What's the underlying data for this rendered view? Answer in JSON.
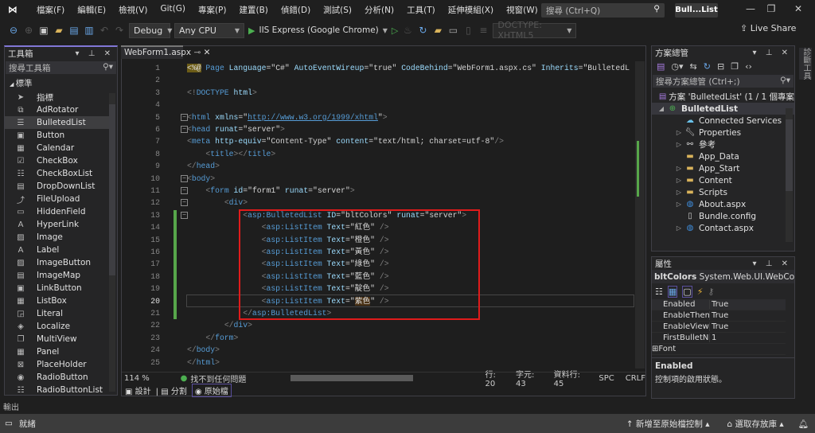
{
  "menu": {
    "items": [
      "檔案(F)",
      "編輯(E)",
      "檢視(V)",
      "Git(G)",
      "專案(P)",
      "建置(B)",
      "偵錯(D)",
      "測試(S)",
      "分析(N)",
      "工具(T)",
      "延伸模組(X)",
      "視窗(W)",
      "說明(H)"
    ],
    "search_placeholder": "搜尋 (Ctrl+Q)",
    "solution_title": "Bull...List"
  },
  "toolbar": {
    "config": "Debug",
    "platform": "Any CPU",
    "run_target": "IIS Express (Google Chrome)",
    "doctype": "DOCTYPE: XHTML5",
    "live_share": "Live Share"
  },
  "toolbox": {
    "title": "工具箱",
    "search_placeholder": "搜尋工具箱",
    "category": "標準",
    "items": [
      {
        "label": "指標",
        "icon": "pointer-icon"
      },
      {
        "label": "AdRotator",
        "icon": "adrotator-icon"
      },
      {
        "label": "BulletedList",
        "icon": "bulleted-list-icon",
        "selected": true
      },
      {
        "label": "Button",
        "icon": "button-icon"
      },
      {
        "label": "Calendar",
        "icon": "calendar-icon"
      },
      {
        "label": "CheckBox",
        "icon": "checkbox-icon"
      },
      {
        "label": "CheckBoxList",
        "icon": "checkbox-list-icon"
      },
      {
        "label": "DropDownList",
        "icon": "dropdown-list-icon"
      },
      {
        "label": "FileUpload",
        "icon": "file-upload-icon"
      },
      {
        "label": "HiddenField",
        "icon": "hidden-field-icon"
      },
      {
        "label": "HyperLink",
        "icon": "hyperlink-icon"
      },
      {
        "label": "Image",
        "icon": "image-icon"
      },
      {
        "label": "Label",
        "icon": "label-icon"
      },
      {
        "label": "ImageButton",
        "icon": "image-button-icon"
      },
      {
        "label": "ImageMap",
        "icon": "image-map-icon"
      },
      {
        "label": "LinkButton",
        "icon": "link-button-icon"
      },
      {
        "label": "ListBox",
        "icon": "listbox-icon"
      },
      {
        "label": "Literal",
        "icon": "literal-icon"
      },
      {
        "label": "Localize",
        "icon": "localize-icon"
      },
      {
        "label": "MultiView",
        "icon": "multiview-icon"
      },
      {
        "label": "Panel",
        "icon": "panel-icon"
      },
      {
        "label": "PlaceHolder",
        "icon": "placeholder-icon"
      },
      {
        "label": "RadioButton",
        "icon": "radio-button-icon"
      },
      {
        "label": "RadioButtonList",
        "icon": "radio-button-list-icon"
      }
    ]
  },
  "editor": {
    "tab": "WebForm1.aspx",
    "current_line": 20,
    "lines": [
      [
        [
          "hl",
          "<%@"
        ],
        [
          "p",
          " "
        ],
        [
          "t",
          "Page"
        ],
        [
          "a",
          " Language"
        ],
        [
          "p",
          "="
        ],
        [
          "s",
          "\"C#\""
        ],
        [
          "a",
          " AutoEventWireup"
        ],
        [
          "p",
          "="
        ],
        [
          "s",
          "\"true\""
        ],
        [
          "a",
          " CodeBehind"
        ],
        [
          "p",
          "="
        ],
        [
          "s",
          "\"WebForm1.aspx.cs\""
        ],
        [
          "a",
          " Inherits"
        ],
        [
          "p",
          "="
        ],
        [
          "s",
          "\"BulletedL"
        ]
      ],
      [],
      [
        [
          "d",
          "<!"
        ],
        [
          "t",
          "DOCTYPE"
        ],
        [
          "a",
          " html"
        ],
        [
          "d",
          ">"
        ]
      ],
      [],
      [
        [
          "d",
          "<"
        ],
        [
          "t",
          "html"
        ],
        [
          "a",
          " xmlns"
        ],
        [
          "p",
          "="
        ],
        [
          "s",
          "\""
        ],
        [
          "u",
          "http://www.w3.org/1999/xhtml"
        ],
        [
          "s",
          "\""
        ],
        [
          "d",
          ">"
        ]
      ],
      [
        [
          "d",
          "<"
        ],
        [
          "t",
          "head"
        ],
        [
          "a",
          " runat"
        ],
        [
          "p",
          "="
        ],
        [
          "s",
          "\"server\""
        ],
        [
          "d",
          ">"
        ]
      ],
      [
        [
          "d",
          "<"
        ],
        [
          "t",
          "meta"
        ],
        [
          "a",
          " http-equiv"
        ],
        [
          "p",
          "="
        ],
        [
          "s",
          "\"Content-Type\""
        ],
        [
          "a",
          " content"
        ],
        [
          "p",
          "="
        ],
        [
          "s",
          "\"text/html; charset=utf-8\""
        ],
        [
          "d",
          "/>"
        ]
      ],
      [
        [
          "p",
          "    "
        ],
        [
          "d",
          "<"
        ],
        [
          "t",
          "title"
        ],
        [
          "d",
          "></"
        ],
        [
          "t",
          "title"
        ],
        [
          "d",
          ">"
        ]
      ],
      [
        [
          "d",
          "</"
        ],
        [
          "t",
          "head"
        ],
        [
          "d",
          ">"
        ]
      ],
      [
        [
          "d",
          "<"
        ],
        [
          "t",
          "body"
        ],
        [
          "d",
          ">"
        ]
      ],
      [
        [
          "p",
          "    "
        ],
        [
          "d",
          "<"
        ],
        [
          "t",
          "form"
        ],
        [
          "a",
          " id"
        ],
        [
          "p",
          "="
        ],
        [
          "s",
          "\"form1\""
        ],
        [
          "a",
          " runat"
        ],
        [
          "p",
          "="
        ],
        [
          "s",
          "\"server\""
        ],
        [
          "d",
          ">"
        ]
      ],
      [
        [
          "p",
          "        "
        ],
        [
          "d",
          "<"
        ],
        [
          "t",
          "div"
        ],
        [
          "d",
          ">"
        ]
      ],
      [
        [
          "p",
          "            "
        ],
        [
          "d",
          "<"
        ],
        [
          "t",
          "asp:BulletedList"
        ],
        [
          "a",
          " ID"
        ],
        [
          "p",
          "="
        ],
        [
          "s",
          "\"bltColors\""
        ],
        [
          "a",
          " runat"
        ],
        [
          "p",
          "="
        ],
        [
          "s",
          "\"server\""
        ],
        [
          "d",
          ">"
        ]
      ],
      [
        [
          "p",
          "                "
        ],
        [
          "d",
          "<"
        ],
        [
          "t",
          "asp:ListItem"
        ],
        [
          "a",
          " Text"
        ],
        [
          "p",
          "="
        ],
        [
          "s",
          "\"紅色\""
        ],
        [
          "d",
          " />"
        ]
      ],
      [
        [
          "p",
          "                "
        ],
        [
          "d",
          "<"
        ],
        [
          "t",
          "asp:ListItem"
        ],
        [
          "a",
          " Text"
        ],
        [
          "p",
          "="
        ],
        [
          "s",
          "\"橙色\""
        ],
        [
          "d",
          " />"
        ]
      ],
      [
        [
          "p",
          "                "
        ],
        [
          "d",
          "<"
        ],
        [
          "t",
          "asp:ListItem"
        ],
        [
          "a",
          " Text"
        ],
        [
          "p",
          "="
        ],
        [
          "s",
          "\"黃色\""
        ],
        [
          "d",
          " />"
        ]
      ],
      [
        [
          "p",
          "                "
        ],
        [
          "d",
          "<"
        ],
        [
          "t",
          "asp:ListItem"
        ],
        [
          "a",
          " Text"
        ],
        [
          "p",
          "="
        ],
        [
          "s",
          "\"綠色\""
        ],
        [
          "d",
          " />"
        ]
      ],
      [
        [
          "p",
          "                "
        ],
        [
          "d",
          "<"
        ],
        [
          "t",
          "asp:ListItem"
        ],
        [
          "a",
          " Text"
        ],
        [
          "p",
          "="
        ],
        [
          "s",
          "\"藍色\""
        ],
        [
          "d",
          " />"
        ]
      ],
      [
        [
          "p",
          "                "
        ],
        [
          "d",
          "<"
        ],
        [
          "t",
          "asp:ListItem"
        ],
        [
          "a",
          " Text"
        ],
        [
          "p",
          "="
        ],
        [
          "s",
          "\"靛色\""
        ],
        [
          "d",
          " />"
        ]
      ],
      [
        [
          "p",
          "                "
        ],
        [
          "d",
          "<"
        ],
        [
          "t",
          "asp:ListItem"
        ],
        [
          "a",
          " Text"
        ],
        [
          "p",
          "="
        ],
        [
          "s",
          "\""
        ],
        [
          "hi",
          "紫色"
        ],
        [
          "s",
          "\""
        ],
        [
          "d",
          " />"
        ]
      ],
      [
        [
          "p",
          "            "
        ],
        [
          "d",
          "</"
        ],
        [
          "t",
          "asp:BulletedList"
        ],
        [
          "d",
          ">"
        ]
      ],
      [
        [
          "p",
          "        "
        ],
        [
          "d",
          "</"
        ],
        [
          "t",
          "div"
        ],
        [
          "d",
          ">"
        ]
      ],
      [
        [
          "p",
          "    "
        ],
        [
          "d",
          "</"
        ],
        [
          "t",
          "form"
        ],
        [
          "d",
          ">"
        ]
      ],
      [
        [
          "d",
          "</"
        ],
        [
          "t",
          "body"
        ],
        [
          "d",
          ">"
        ]
      ],
      [
        [
          "d",
          "</"
        ],
        [
          "t",
          "html"
        ],
        [
          "d",
          ">"
        ]
      ]
    ],
    "status": {
      "zoom": "114 %",
      "issues": "找不到任何問題",
      "line": "行: 20",
      "char": "字元: 43",
      "col": "資料行: 45",
      "spc": "SPC",
      "eol": "CRLF"
    },
    "view_tabs": [
      "設計",
      "分割",
      "原始檔"
    ]
  },
  "solution_explorer": {
    "title": "方案總管",
    "search_placeholder": "搜尋方案總管 (Ctrl+;)",
    "items": [
      {
        "label": "方案 'BulletedList' (1 / 1 個專案",
        "level": 0,
        "exp": "",
        "icon": "solution-icon"
      },
      {
        "label": "BulletedList",
        "level": 0,
        "exp": "◢",
        "icon": "web-project-icon",
        "selected": true
      },
      {
        "label": "Connected Services",
        "level": 1,
        "exp": "",
        "icon": "connected-services-icon"
      },
      {
        "label": "Properties",
        "level": 1,
        "exp": "▷",
        "icon": "wrench-icon"
      },
      {
        "label": "參考",
        "level": 1,
        "exp": "▷",
        "icon": "references-icon"
      },
      {
        "label": "App_Data",
        "level": 1,
        "exp": "",
        "icon": "folder-icon"
      },
      {
        "label": "App_Start",
        "level": 1,
        "exp": "▷",
        "icon": "folder-icon"
      },
      {
        "label": "Content",
        "level": 1,
        "exp": "▷",
        "icon": "folder-icon"
      },
      {
        "label": "Scripts",
        "level": 1,
        "exp": "▷",
        "icon": "folder-icon"
      },
      {
        "label": "About.aspx",
        "level": 1,
        "exp": "▷",
        "icon": "aspx-file-icon"
      },
      {
        "label": "Bundle.config",
        "level": 1,
        "exp": "",
        "icon": "config-file-icon"
      },
      {
        "label": "Contact.aspx",
        "level": 1,
        "exp": "▷",
        "icon": "aspx-file-icon"
      }
    ]
  },
  "properties": {
    "title": "屬性",
    "object": "bltColors",
    "type": "System.Web.UI.WebCon",
    "rows": [
      [
        "Enabled",
        "True"
      ],
      [
        "EnableTheming",
        "True"
      ],
      [
        "EnableViewStat",
        "True"
      ],
      [
        "FirstBulletNumt",
        "1"
      ],
      [
        "Font",
        ""
      ]
    ],
    "desc_title": "Enabled",
    "desc_text": "控制項的啟用狀態。"
  },
  "right_tab": "診斷工具",
  "output_tab": "輸出",
  "statusbar": {
    "ready": "就緒",
    "add_source_control": "新增至原始檔控制",
    "select_repo": "選取存放庫"
  }
}
